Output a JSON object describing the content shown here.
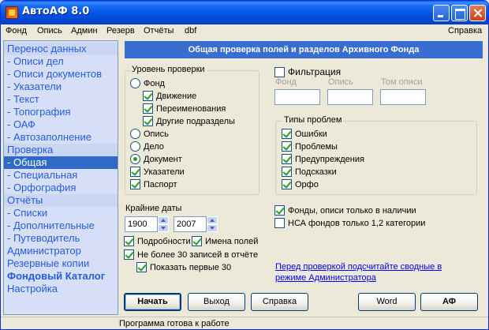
{
  "window": {
    "title": "АвтоАФ 8.0"
  },
  "menu": {
    "fond": "Фонд",
    "opis": "Опись",
    "admin": "Админ",
    "rezerv": "Резерв",
    "otchety": "Отчёты",
    "dbf": "dbf",
    "spravka": "Справка"
  },
  "sidebar": {
    "items": [
      {
        "label": "Перенос данных",
        "kind": "section"
      },
      {
        "label": "- Описи дел",
        "kind": "sub"
      },
      {
        "label": "- Описи документов",
        "kind": "sub"
      },
      {
        "label": "- Указатели",
        "kind": "sub"
      },
      {
        "label": "- Текст",
        "kind": "sub"
      },
      {
        "label": "- Топография",
        "kind": "sub"
      },
      {
        "label": "- ОАФ",
        "kind": "sub"
      },
      {
        "label": "- Автозаполнение",
        "kind": "sub"
      },
      {
        "label": "Проверка",
        "kind": "section"
      },
      {
        "label": "- Общая",
        "kind": "active"
      },
      {
        "label": "- Специальная",
        "kind": "sub"
      },
      {
        "label": "- Орфография",
        "kind": "sub"
      },
      {
        "label": "Отчёты",
        "kind": "section"
      },
      {
        "label": "- Списки",
        "kind": "sub"
      },
      {
        "label": "- Дополнительные",
        "kind": "sub"
      },
      {
        "label": "- Путеводитель",
        "kind": "sub"
      },
      {
        "label": "Администратор",
        "kind": "plain"
      },
      {
        "label": "Резервные копии",
        "kind": "plain"
      },
      {
        "label": "Фондовый Каталог",
        "kind": "bold"
      },
      {
        "label": "Настройка",
        "kind": "plain"
      }
    ]
  },
  "header": {
    "title": "Общая проверка полей и разделов Архивного Фонда"
  },
  "level": {
    "title": "Уровень проверки",
    "fond": "Фонд",
    "dvizhenie": "Движение",
    "pereimenovaniya": "Переименования",
    "drugie": "Другие подразделы",
    "opis": "Опись",
    "delo": "Дело",
    "dokument": "Документ",
    "ukazateli": "Указатели",
    "pasport": "Паспорт"
  },
  "filter": {
    "label": "Фильтрация",
    "fond_label": "Фонд",
    "opis_label": "Опись",
    "tom_label": "Том описи",
    "fond_value": "",
    "opis_value": "",
    "tom_value": ""
  },
  "problems": {
    "title": "Типы проблем",
    "errors": "Ошибки",
    "problems": "Проблемы",
    "warnings": "Предупреждения",
    "hints": "Подсказки",
    "orfo": "Орфо"
  },
  "dates": {
    "title": "Крайние даты",
    "from": "1900",
    "to": "2007"
  },
  "options": {
    "podrobnosti": "Подробности",
    "imena_poley": "Имена полей",
    "ne_bolee": "Не более 30 записей в отчёте",
    "pokazat": "Показать первые 30",
    "fondy_nalichii": "Фонды, описи только в наличии",
    "nsa": "НСА фондов только 1,2 категории"
  },
  "link": {
    "text": "Перед проверкой подсчитайте сводные в режиме Администратора"
  },
  "buttons": {
    "start": "Начать",
    "exit": "Выход",
    "help": "Справка",
    "word": "Word",
    "af": "АФ"
  },
  "status": {
    "text": "Программа готова к работе"
  }
}
